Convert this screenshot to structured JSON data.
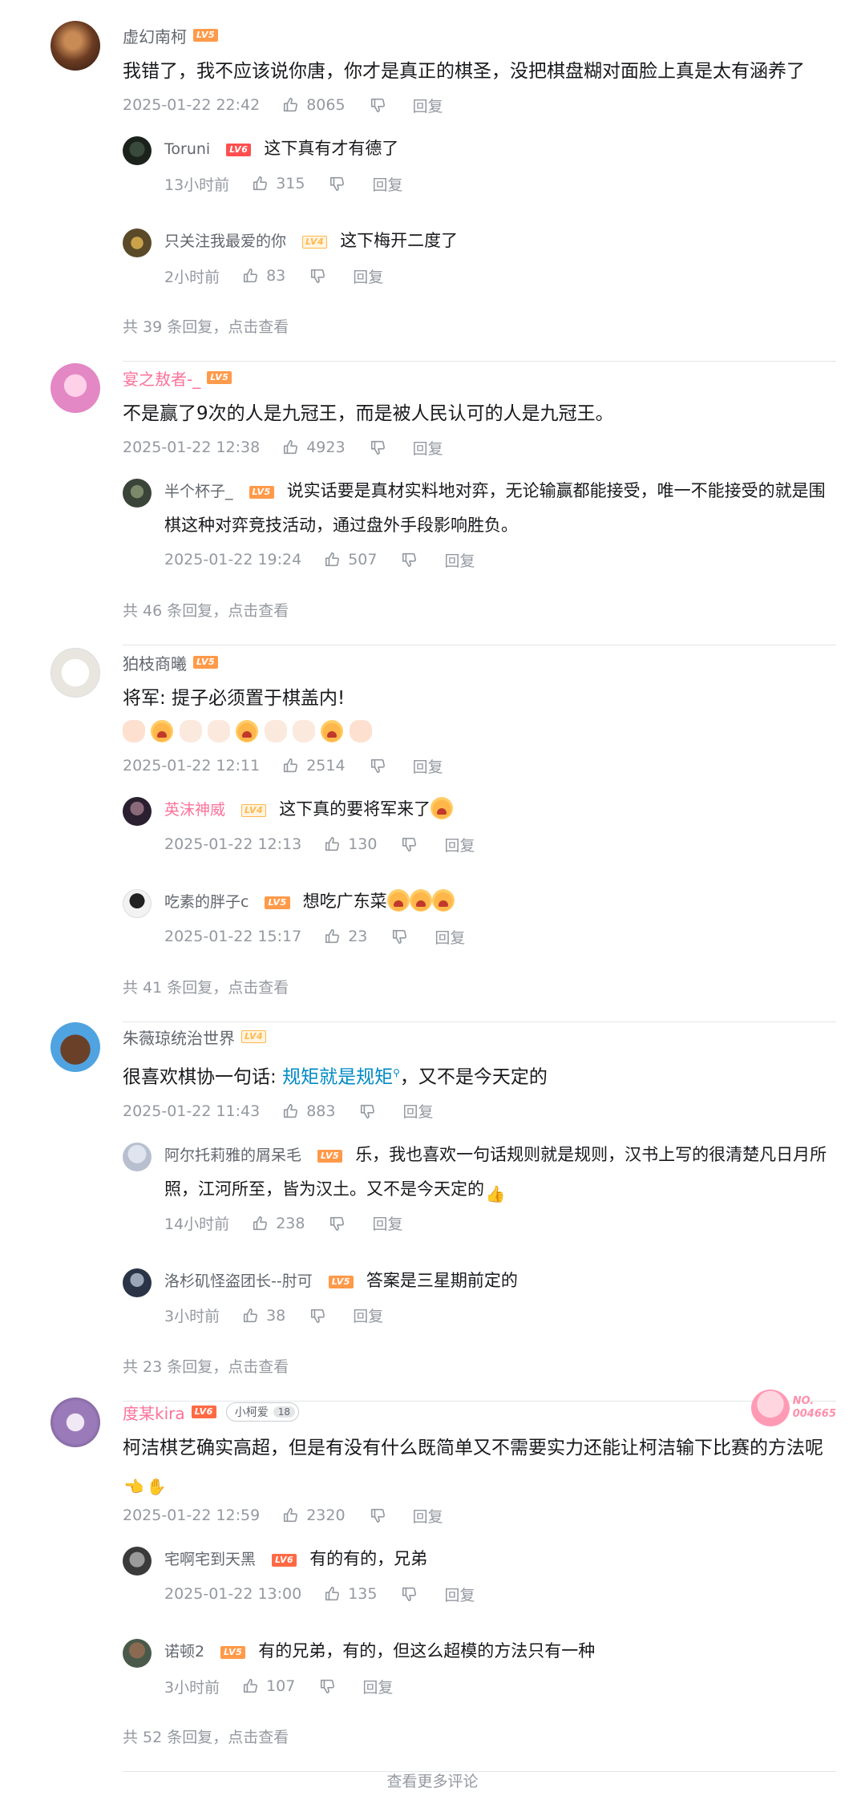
{
  "comments": [
    {
      "user": "虚幻南柯",
      "level": "LV5",
      "content": "我错了，我不应该说你唐，你才是真正的棋圣，没把棋盘糊对面脸上真是太有涵养了",
      "time": "2025-01-22 22:42",
      "likes": "8065",
      "reply_label": "回复",
      "replies": [
        {
          "user": "Toruni",
          "level": "LV6",
          "text": "这下真有才有德了",
          "time": "13小时前",
          "likes": "315"
        },
        {
          "user": "只关注我最爱的你",
          "level": "LV4",
          "text": "这下梅开二度了",
          "time": "2小时前",
          "likes": "83"
        }
      ],
      "reply_count": "共 39 条回复，点击查看"
    },
    {
      "user": "宴之敖者-_",
      "level": "LV5",
      "content": "不是赢了9次的人是九冠王，而是被人民认可的人是九冠王。",
      "time": "2025-01-22 12:38",
      "likes": "4923",
      "reply_label": "回复",
      "replies": [
        {
          "user": "半个杯子_",
          "level": "LV5",
          "text": "说实话要是真材实料地对弈，无论输赢都能接受，唯一不能接受的就是围棋这种对弈竞技活动，通过盘外手段影响胜负。",
          "time": "2025-01-22 19:24",
          "likes": "507"
        }
      ],
      "reply_count": "共 46 条回复，点击查看"
    },
    {
      "user": "狛枝商曦",
      "level": "LV5",
      "content": "将军: 提子必须置于棋盖内!",
      "time": "2025-01-22 12:11",
      "likes": "2514",
      "reply_label": "回复",
      "replies": [
        {
          "user": "英沫神威",
          "level": "LV4",
          "text": "这下真的要将军来了",
          "time": "2025-01-22 12:13",
          "likes": "130"
        },
        {
          "user": "吃素的胖子c",
          "level": "LV5",
          "text": "想吃广东菜",
          "time": "2025-01-22 15:17",
          "likes": "23"
        }
      ],
      "reply_count": "共 41 条回复，点击查看"
    },
    {
      "user": "朱薇琼统治世界",
      "level": "LV4",
      "content_before": "很喜欢棋协一句话: ",
      "keyword": "规矩就是规矩",
      "content_after": "，又不是今天定的",
      "time": "2025-01-22 11:43",
      "likes": "883",
      "reply_label": "回复",
      "replies": [
        {
          "user": "阿尔托莉雅的屑呆毛",
          "level": "LV5",
          "text": "乐，我也喜欢一句话规则就是规则，汉书上写的很清楚凡日月所照，江河所至，皆为汉土。又不是今天定的",
          "time": "14小时前",
          "likes": "238"
        },
        {
          "user": "洛杉矶怪盗团长--肘可",
          "level": "LV5",
          "text": "答案是三星期前定的",
          "time": "3小时前",
          "likes": "38"
        }
      ],
      "reply_count": "共 23 条回复，点击查看"
    },
    {
      "user": "度某kira",
      "level": "LV6",
      "fan_badge": "小柯爱",
      "fan_level": "18",
      "decor_no": "NO.",
      "decor_num": "004665",
      "content": "柯洁棋艺确实高超，但是有没有什么既简单又不需要实力还能让柯洁输下比赛的方法呢",
      "time": "2025-01-22 12:59",
      "likes": "2320",
      "reply_label": "回复",
      "replies": [
        {
          "user": "宅啊宅到天黑",
          "level": "LV6",
          "text": "有的有的，兄弟",
          "time": "2025-01-22 13:00",
          "likes": "135"
        },
        {
          "user": "诺顿2",
          "level": "LV5",
          "text": "有的兄弟，有的，但这么超模的方法只有一种",
          "time": "3小时前",
          "likes": "107"
        }
      ],
      "reply_count": "共 52 条回复，点击查看"
    }
  ],
  "view_more": "查看更多评论",
  "reply_label": "回复",
  "colors": {
    "pink_name": "#fb7299",
    "keyword": "#008ac5",
    "meta": "#9499a0"
  }
}
